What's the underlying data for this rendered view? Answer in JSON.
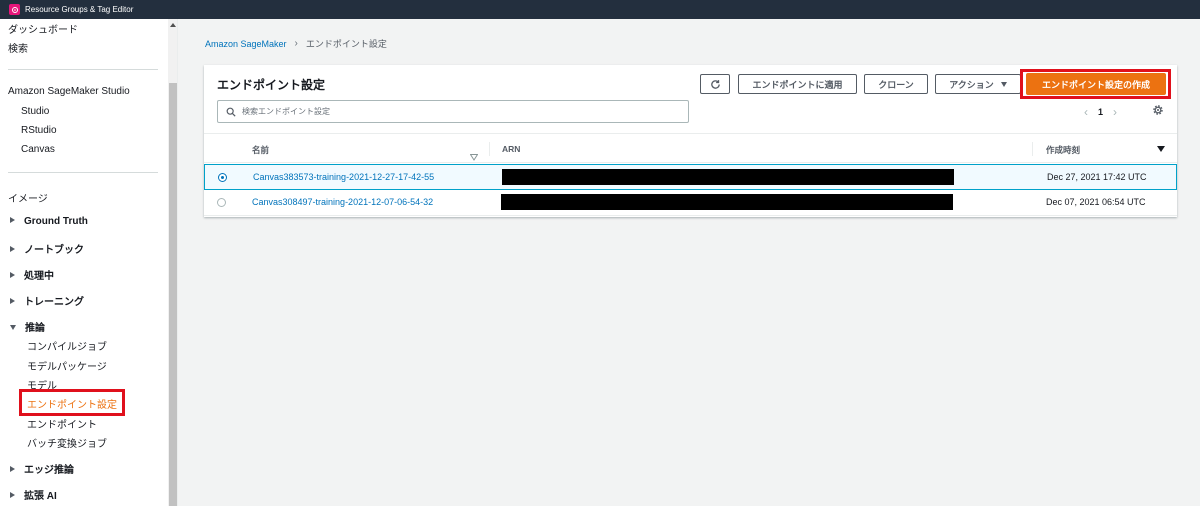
{
  "app": {
    "title": "Resource Groups & Tag Editor"
  },
  "sidebar": {
    "top_items": [
      "ダッシュボード",
      "検索"
    ],
    "studio_section": {
      "heading": "Amazon SageMaker Studio",
      "items": [
        "Studio",
        "RStudio",
        "Canvas"
      ]
    },
    "images_label": "イメージ",
    "groups": [
      {
        "label": "Ground Truth",
        "expanded": false
      },
      {
        "label": "ノートブック",
        "expanded": false
      },
      {
        "label": "処理中",
        "expanded": false
      },
      {
        "label": "トレーニング",
        "expanded": false
      }
    ],
    "inference": {
      "label": "推論",
      "expanded": true,
      "items": [
        "コンパイルジョブ",
        "モデルパッケージ",
        "モデル",
        "エンドポイント設定",
        "エンドポイント",
        "バッチ変換ジョブ"
      ],
      "active_item": "エンドポイント設定"
    },
    "bottom_groups": [
      {
        "label": "エッジ推論",
        "expanded": false
      },
      {
        "label": "拡張 AI",
        "expanded": false
      }
    ]
  },
  "breadcrumb": {
    "parent": "Amazon SageMaker",
    "current": "エンドポイント設定"
  },
  "panel": {
    "title": "エンドポイント設定",
    "buttons": {
      "apply": "エンドポイントに適用",
      "clone": "クローン",
      "action": "アクション",
      "create": "エンドポイント設定の作成"
    },
    "search_placeholder": "検索エンドポイント設定",
    "pager": {
      "current_page": "1"
    },
    "columns": {
      "name": "名前",
      "arn": "ARN",
      "created": "作成時刻"
    },
    "rows": [
      {
        "name": "Canvas383573-training-2021-12-27-17-42-55",
        "created": "Dec 27, 2021 17:42 UTC",
        "selected": true
      },
      {
        "name": "Canvas308497-training-2021-12-07-06-54-32",
        "created": "Dec 07, 2021 06:54 UTC",
        "selected": false
      }
    ]
  },
  "colors": {
    "topbar": "#232f3e",
    "accent_orange": "#ec7211",
    "link_blue": "#0073bb",
    "highlight_red": "#e0101c"
  }
}
